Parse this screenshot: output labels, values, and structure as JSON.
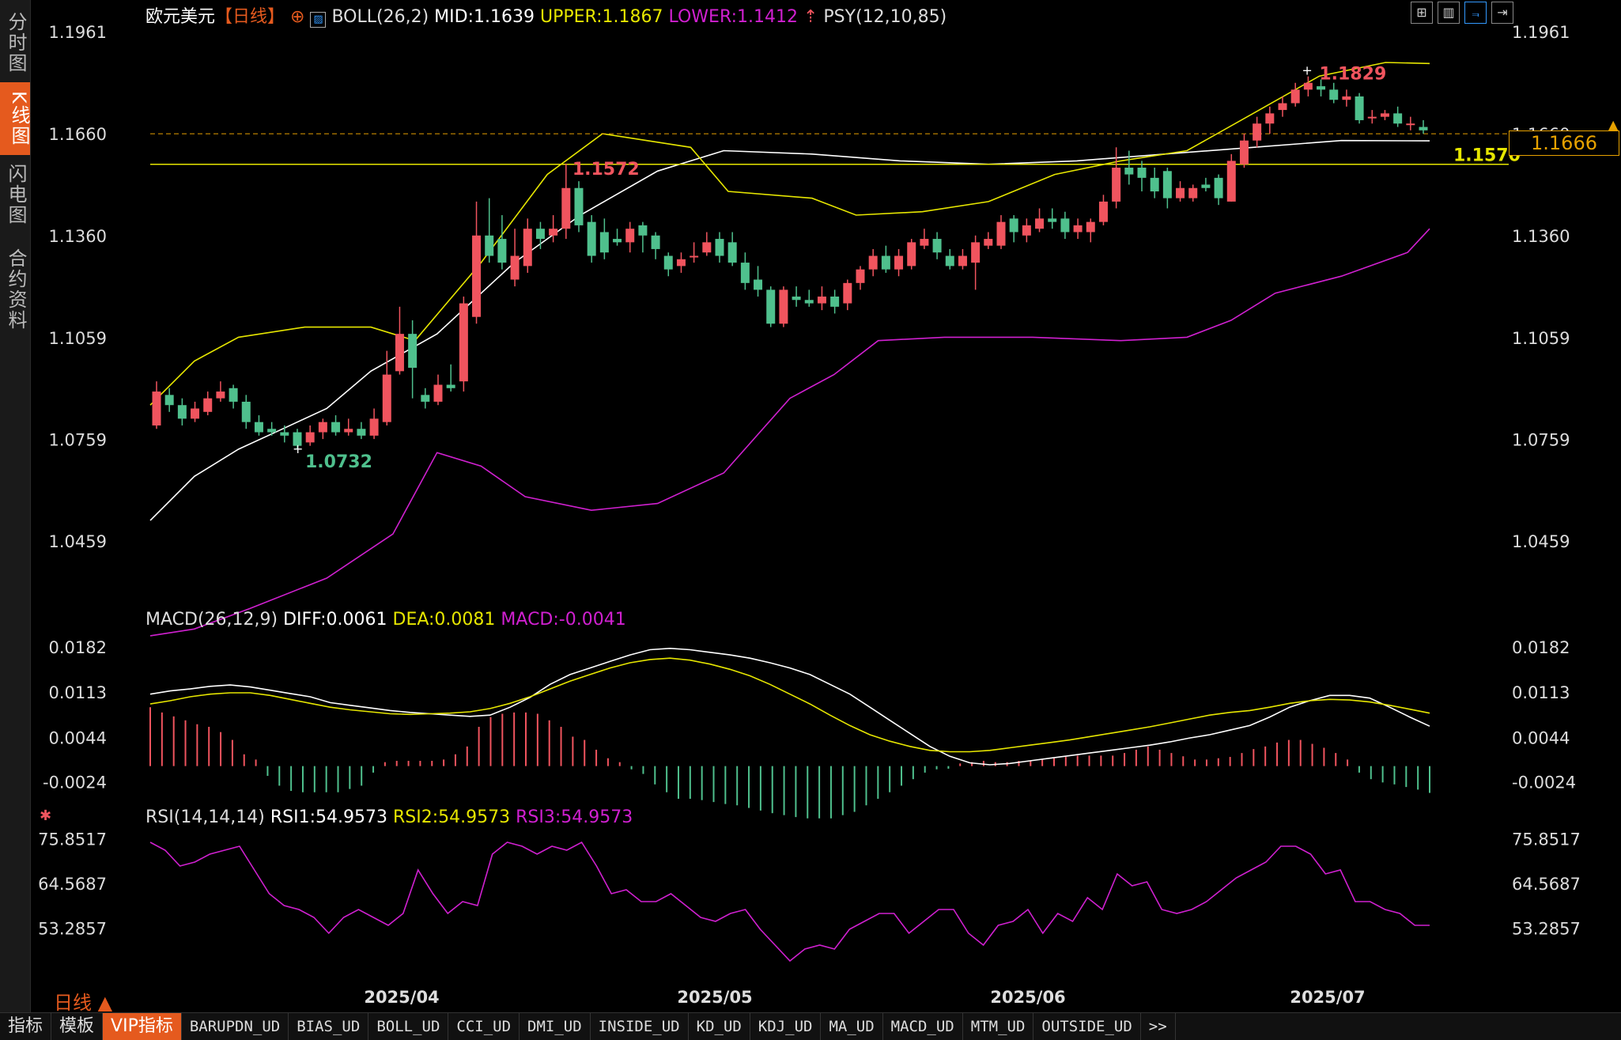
{
  "sidebar": {
    "tabs": [
      "分时图",
      "K线图",
      "闪电图",
      "合约资料"
    ],
    "active": 1
  },
  "header": {
    "symbol": "欧元美元",
    "period_tag": "【日线】",
    "boll": "BOLL(26,2)",
    "mid": "MID:1.1639",
    "upper": "UPPER:1.1867",
    "lower": "LOWER:1.1412",
    "psy": "PSY(12,10,85)"
  },
  "toolbar": {
    "icons": [
      "grid-icon",
      "candle-chart-icon",
      "line-chart-icon",
      "expand-icon"
    ]
  },
  "price_tag": "1.1666",
  "macd_header": {
    "label": "MACD(26,12,9)",
    "diff": "DIFF:0.0061",
    "dea": "DEA:0.0081",
    "macd": "MACD:-0.0041"
  },
  "rsi_header": {
    "label": "RSI(14,14,14)",
    "rsi1": "RSI1:54.9573",
    "rsi2": "RSI2:54.9573",
    "rsi3": "RSI3:54.9573"
  },
  "period_label": "日线 ▲",
  "bottom_tabs": [
    "指标",
    "模板",
    "VIP指标",
    "BARUPDN_UD",
    "BIAS_UD",
    "BOLL_UD",
    "CCI_UD",
    "DMI_UD",
    "INSIDE_UD",
    "KD_UD",
    "KDJ_UD",
    "MA_UD",
    "MACD_UD",
    "MTM_UD",
    "OUTSIDE_UD",
    ">>"
  ],
  "bottom_active": 2,
  "colors": {
    "up": "#f0545e",
    "down": "#4fc08d",
    "mid": "#ffffff",
    "upper": "#e6e600",
    "lower": "#d020d0",
    "macd_up": "#f0545e",
    "macd_down": "#4fc08d",
    "hline": "#e6e600",
    "accent": "#e55a1e"
  },
  "chart_data": {
    "type": "candlestick",
    "x_labels": [
      "2025/04",
      "2025/05",
      "2025/06",
      "2025/07"
    ],
    "price_ticks": [
      "1.1961",
      "1.1660",
      "1.1360",
      "1.1059",
      "1.0759",
      "1.0459"
    ],
    "price_ylim": [
      1.0259,
      1.1961
    ],
    "annotations": {
      "high_label": "1.1829",
      "high_value": 1.1829,
      "mid_high_label": "1.1572",
      "mid_high_value": 1.1572,
      "low_label": "1.0732",
      "low_value": 1.0732,
      "hline_label": "1.1570",
      "hline_value": 1.157,
      "last_price": 1.166
    },
    "candles": [
      {
        "o": 1.08,
        "c": 1.09,
        "h": 1.093,
        "l": 1.079
      },
      {
        "o": 1.089,
        "c": 1.086,
        "h": 1.091,
        "l": 1.084
      },
      {
        "o": 1.086,
        "c": 1.082,
        "h": 1.088,
        "l": 1.08
      },
      {
        "o": 1.082,
        "c": 1.085,
        "h": 1.087,
        "l": 1.081
      },
      {
        "o": 1.084,
        "c": 1.088,
        "h": 1.09,
        "l": 1.083
      },
      {
        "o": 1.088,
        "c": 1.09,
        "h": 1.093,
        "l": 1.087
      },
      {
        "o": 1.091,
        "c": 1.087,
        "h": 1.092,
        "l": 1.085
      },
      {
        "o": 1.087,
        "c": 1.081,
        "h": 1.089,
        "l": 1.079
      },
      {
        "o": 1.081,
        "c": 1.078,
        "h": 1.083,
        "l": 1.077
      },
      {
        "o": 1.079,
        "c": 1.078,
        "h": 1.081,
        "l": 1.077
      },
      {
        "o": 1.078,
        "c": 1.077,
        "h": 1.08,
        "l": 1.075
      },
      {
        "o": 1.078,
        "c": 1.074,
        "h": 1.079,
        "l": 1.0732
      },
      {
        "o": 1.075,
        "c": 1.078,
        "h": 1.08,
        "l": 1.074
      },
      {
        "o": 1.078,
        "c": 1.081,
        "h": 1.082,
        "l": 1.076
      },
      {
        "o": 1.081,
        "c": 1.078,
        "h": 1.083,
        "l": 1.077
      },
      {
        "o": 1.078,
        "c": 1.079,
        "h": 1.082,
        "l": 1.077
      },
      {
        "o": 1.079,
        "c": 1.077,
        "h": 1.081,
        "l": 1.076
      },
      {
        "o": 1.077,
        "c": 1.082,
        "h": 1.085,
        "l": 1.076
      },
      {
        "o": 1.081,
        "c": 1.095,
        "h": 1.102,
        "l": 1.08
      },
      {
        "o": 1.096,
        "c": 1.107,
        "h": 1.115,
        "l": 1.095
      },
      {
        "o": 1.107,
        "c": 1.097,
        "h": 1.111,
        "l": 1.088
      },
      {
        "o": 1.089,
        "c": 1.087,
        "h": 1.091,
        "l": 1.085
      },
      {
        "o": 1.087,
        "c": 1.092,
        "h": 1.095,
        "l": 1.086
      },
      {
        "o": 1.092,
        "c": 1.091,
        "h": 1.098,
        "l": 1.09
      },
      {
        "o": 1.093,
        "c": 1.116,
        "h": 1.118,
        "l": 1.09
      },
      {
        "o": 1.112,
        "c": 1.136,
        "h": 1.146,
        "l": 1.11
      },
      {
        "o": 1.136,
        "c": 1.13,
        "h": 1.147,
        "l": 1.128
      },
      {
        "o": 1.135,
        "c": 1.128,
        "h": 1.142,
        "l": 1.126
      },
      {
        "o": 1.123,
        "c": 1.13,
        "h": 1.138,
        "l": 1.121
      },
      {
        "o": 1.127,
        "c": 1.138,
        "h": 1.141,
        "l": 1.125
      },
      {
        "o": 1.138,
        "c": 1.135,
        "h": 1.14,
        "l": 1.132
      },
      {
        "o": 1.136,
        "c": 1.138,
        "h": 1.142,
        "l": 1.134
      },
      {
        "o": 1.138,
        "c": 1.15,
        "h": 1.1572,
        "l": 1.135
      },
      {
        "o": 1.15,
        "c": 1.139,
        "h": 1.152,
        "l": 1.137
      },
      {
        "o": 1.14,
        "c": 1.13,
        "h": 1.142,
        "l": 1.128
      },
      {
        "o": 1.137,
        "c": 1.131,
        "h": 1.141,
        "l": 1.129
      },
      {
        "o": 1.135,
        "c": 1.134,
        "h": 1.138,
        "l": 1.133
      },
      {
        "o": 1.134,
        "c": 1.138,
        "h": 1.14,
        "l": 1.131
      },
      {
        "o": 1.139,
        "c": 1.136,
        "h": 1.14,
        "l": 1.131
      },
      {
        "o": 1.136,
        "c": 1.132,
        "h": 1.137,
        "l": 1.129
      },
      {
        "o": 1.13,
        "c": 1.126,
        "h": 1.131,
        "l": 1.124
      },
      {
        "o": 1.127,
        "c": 1.129,
        "h": 1.131,
        "l": 1.125
      },
      {
        "o": 1.13,
        "c": 1.13,
        "h": 1.134,
        "l": 1.128
      },
      {
        "o": 1.131,
        "c": 1.134,
        "h": 1.137,
        "l": 1.13
      },
      {
        "o": 1.135,
        "c": 1.13,
        "h": 1.137,
        "l": 1.128
      },
      {
        "o": 1.134,
        "c": 1.128,
        "h": 1.137,
        "l": 1.127
      },
      {
        "o": 1.128,
        "c": 1.122,
        "h": 1.131,
        "l": 1.12
      },
      {
        "o": 1.123,
        "c": 1.12,
        "h": 1.127,
        "l": 1.118
      },
      {
        "o": 1.12,
        "c": 1.11,
        "h": 1.121,
        "l": 1.109
      },
      {
        "o": 1.11,
        "c": 1.12,
        "h": 1.121,
        "l": 1.109
      },
      {
        "o": 1.118,
        "c": 1.117,
        "h": 1.121,
        "l": 1.115
      },
      {
        "o": 1.117,
        "c": 1.116,
        "h": 1.12,
        "l": 1.115
      },
      {
        "o": 1.116,
        "c": 1.118,
        "h": 1.121,
        "l": 1.114
      },
      {
        "o": 1.118,
        "c": 1.115,
        "h": 1.12,
        "l": 1.113
      },
      {
        "o": 1.116,
        "c": 1.122,
        "h": 1.123,
        "l": 1.114
      },
      {
        "o": 1.122,
        "c": 1.126,
        "h": 1.127,
        "l": 1.12
      },
      {
        "o": 1.126,
        "c": 1.13,
        "h": 1.132,
        "l": 1.124
      },
      {
        "o": 1.13,
        "c": 1.126,
        "h": 1.133,
        "l": 1.125
      },
      {
        "o": 1.126,
        "c": 1.13,
        "h": 1.132,
        "l": 1.124
      },
      {
        "o": 1.127,
        "c": 1.134,
        "h": 1.135,
        "l": 1.126
      },
      {
        "o": 1.133,
        "c": 1.135,
        "h": 1.138,
        "l": 1.132
      },
      {
        "o": 1.135,
        "c": 1.131,
        "h": 1.137,
        "l": 1.129
      },
      {
        "o": 1.13,
        "c": 1.127,
        "h": 1.132,
        "l": 1.126
      },
      {
        "o": 1.127,
        "c": 1.13,
        "h": 1.132,
        "l": 1.126
      },
      {
        "o": 1.128,
        "c": 1.134,
        "h": 1.136,
        "l": 1.12
      },
      {
        "o": 1.133,
        "c": 1.135,
        "h": 1.137,
        "l": 1.132
      },
      {
        "o": 1.133,
        "c": 1.14,
        "h": 1.142,
        "l": 1.132
      },
      {
        "o": 1.141,
        "c": 1.137,
        "h": 1.142,
        "l": 1.134
      },
      {
        "o": 1.136,
        "c": 1.139,
        "h": 1.141,
        "l": 1.134
      },
      {
        "o": 1.138,
        "c": 1.141,
        "h": 1.144,
        "l": 1.137
      },
      {
        "o": 1.141,
        "c": 1.14,
        "h": 1.144,
        "l": 1.138
      },
      {
        "o": 1.141,
        "c": 1.137,
        "h": 1.143,
        "l": 1.135
      },
      {
        "o": 1.137,
        "c": 1.139,
        "h": 1.141,
        "l": 1.135
      },
      {
        "o": 1.137,
        "c": 1.14,
        "h": 1.141,
        "l": 1.134
      },
      {
        "o": 1.14,
        "c": 1.146,
        "h": 1.148,
        "l": 1.139
      },
      {
        "o": 1.146,
        "c": 1.156,
        "h": 1.162,
        "l": 1.144
      },
      {
        "o": 1.156,
        "c": 1.154,
        "h": 1.161,
        "l": 1.151
      },
      {
        "o": 1.156,
        "c": 1.153,
        "h": 1.158,
        "l": 1.149
      },
      {
        "o": 1.153,
        "c": 1.149,
        "h": 1.156,
        "l": 1.147
      },
      {
        "o": 1.155,
        "c": 1.147,
        "h": 1.156,
        "l": 1.144
      },
      {
        "o": 1.147,
        "c": 1.15,
        "h": 1.152,
        "l": 1.146
      },
      {
        "o": 1.147,
        "c": 1.15,
        "h": 1.151,
        "l": 1.146
      },
      {
        "o": 1.151,
        "c": 1.15,
        "h": 1.153,
        "l": 1.149
      },
      {
        "o": 1.153,
        "c": 1.147,
        "h": 1.154,
        "l": 1.145
      },
      {
        "o": 1.146,
        "c": 1.158,
        "h": 1.16,
        "l": 1.146
      },
      {
        "o": 1.157,
        "c": 1.164,
        "h": 1.166,
        "l": 1.156
      },
      {
        "o": 1.164,
        "c": 1.169,
        "h": 1.171,
        "l": 1.162
      },
      {
        "o": 1.169,
        "c": 1.172,
        "h": 1.174,
        "l": 1.166
      },
      {
        "o": 1.173,
        "c": 1.175,
        "h": 1.177,
        "l": 1.171
      },
      {
        "o": 1.175,
        "c": 1.179,
        "h": 1.181,
        "l": 1.174
      },
      {
        "o": 1.179,
        "c": 1.181,
        "h": 1.1829,
        "l": 1.177
      },
      {
        "o": 1.18,
        "c": 1.179,
        "h": 1.182,
        "l": 1.177
      },
      {
        "o": 1.179,
        "c": 1.176,
        "h": 1.181,
        "l": 1.175
      },
      {
        "o": 1.176,
        "c": 1.177,
        "h": 1.179,
        "l": 1.174
      },
      {
        "o": 1.177,
        "c": 1.17,
        "h": 1.178,
        "l": 1.169
      },
      {
        "o": 1.171,
        "c": 1.171,
        "h": 1.173,
        "l": 1.169
      },
      {
        "o": 1.171,
        "c": 1.172,
        "h": 1.173,
        "l": 1.17
      },
      {
        "o": 1.172,
        "c": 1.169,
        "h": 1.174,
        "l": 1.168
      },
      {
        "o": 1.169,
        "c": 1.169,
        "h": 1.171,
        "l": 1.167
      },
      {
        "o": 1.168,
        "c": 1.167,
        "h": 1.17,
        "l": 1.166
      }
    ],
    "boll_mid": [
      [
        0,
        1.052
      ],
      [
        20,
        1.065
      ],
      [
        40,
        1.073
      ],
      [
        60,
        1.079
      ],
      [
        80,
        1.085
      ],
      [
        100,
        1.096
      ],
      [
        130,
        1.107
      ],
      [
        165,
        1.128
      ],
      [
        195,
        1.142
      ],
      [
        230,
        1.155
      ],
      [
        260,
        1.161
      ],
      [
        300,
        1.16
      ],
      [
        340,
        1.158
      ],
      [
        380,
        1.157
      ],
      [
        420,
        1.158
      ],
      [
        460,
        1.16
      ],
      [
        500,
        1.162
      ],
      [
        540,
        1.164
      ],
      [
        580,
        1.1639
      ]
    ],
    "boll_upper": [
      [
        0,
        1.086
      ],
      [
        20,
        1.099
      ],
      [
        40,
        1.106
      ],
      [
        70,
        1.109
      ],
      [
        100,
        1.109
      ],
      [
        120,
        1.105
      ],
      [
        150,
        1.128
      ],
      [
        180,
        1.154
      ],
      [
        205,
        1.166
      ],
      [
        245,
        1.162
      ],
      [
        262,
        1.149
      ],
      [
        300,
        1.147
      ],
      [
        320,
        1.142
      ],
      [
        350,
        1.143
      ],
      [
        380,
        1.146
      ],
      [
        410,
        1.154
      ],
      [
        440,
        1.158
      ],
      [
        470,
        1.161
      ],
      [
        500,
        1.172
      ],
      [
        530,
        1.183
      ],
      [
        560,
        1.187
      ],
      [
        580,
        1.1867
      ]
    ],
    "boll_lower": [
      [
        0,
        1.018
      ],
      [
        20,
        1.02
      ],
      [
        45,
        1.026
      ],
      [
        80,
        1.035
      ],
      [
        110,
        1.048
      ],
      [
        130,
        1.072
      ],
      [
        150,
        1.068
      ],
      [
        170,
        1.059
      ],
      [
        200,
        1.055
      ],
      [
        230,
        1.057
      ],
      [
        260,
        1.066
      ],
      [
        290,
        1.088
      ],
      [
        310,
        1.095
      ],
      [
        330,
        1.105
      ],
      [
        360,
        1.106
      ],
      [
        400,
        1.106
      ],
      [
        440,
        1.105
      ],
      [
        470,
        1.106
      ],
      [
        490,
        1.111
      ],
      [
        510,
        1.119
      ],
      [
        540,
        1.124
      ],
      [
        570,
        1.131
      ],
      [
        580,
        1.138
      ]
    ],
    "macd_ticks": [
      "0.0182",
      "0.0113",
      "0.0044",
      "-0.0024"
    ],
    "macd_ylim": [
      -0.005,
      0.021
    ],
    "macd_diff": [
      0.011,
      0.0115,
      0.0118,
      0.0122,
      0.0124,
      0.0121,
      0.0116,
      0.0111,
      0.0106,
      0.0097,
      0.0093,
      0.0089,
      0.0085,
      0.0082,
      0.008,
      0.0078,
      0.0076,
      0.0078,
      0.009,
      0.0105,
      0.0125,
      0.014,
      0.015,
      0.016,
      0.017,
      0.0178,
      0.018,
      0.0178,
      0.0174,
      0.017,
      0.0165,
      0.0158,
      0.015,
      0.014,
      0.0125,
      0.011,
      0.009,
      0.007,
      0.005,
      0.003,
      0.0015,
      0.0005,
      0.0002,
      0.0004,
      0.0008,
      0.0012,
      0.0016,
      0.002,
      0.0024,
      0.0028,
      0.0032,
      0.0037,
      0.0043,
      0.0048,
      0.0055,
      0.0062,
      0.0075,
      0.009,
      0.01,
      0.0108,
      0.0108,
      0.0104,
      0.009,
      0.0075,
      0.0061
    ],
    "macd_dea": [
      0.0095,
      0.01,
      0.0106,
      0.011,
      0.0112,
      0.0112,
      0.0108,
      0.0102,
      0.0096,
      0.009,
      0.0086,
      0.0083,
      0.008,
      0.0079,
      0.008,
      0.0081,
      0.0083,
      0.0088,
      0.0096,
      0.0106,
      0.0118,
      0.013,
      0.014,
      0.015,
      0.0158,
      0.0163,
      0.0165,
      0.0162,
      0.0156,
      0.0148,
      0.0138,
      0.0125,
      0.011,
      0.0095,
      0.0078,
      0.0062,
      0.0048,
      0.0038,
      0.003,
      0.0024,
      0.0022,
      0.0022,
      0.0024,
      0.0028,
      0.0032,
      0.0036,
      0.004,
      0.0045,
      0.005,
      0.0055,
      0.006,
      0.0066,
      0.0072,
      0.0078,
      0.0082,
      0.0085,
      0.009,
      0.0096,
      0.01,
      0.0102,
      0.0101,
      0.0098,
      0.0093,
      0.0087,
      0.0081
    ],
    "macd_bars": [
      0.009,
      0.0082,
      0.0076,
      0.007,
      0.0064,
      0.006,
      0.0052,
      0.004,
      0.0018,
      0.001,
      -0.0015,
      -0.003,
      -0.0038,
      -0.004,
      -0.004,
      -0.004,
      -0.004,
      -0.0035,
      -0.003,
      -0.001,
      0.0006,
      0.0008,
      0.0008,
      0.0008,
      0.0008,
      0.001,
      0.0018,
      0.003,
      0.006,
      0.0075,
      0.008,
      0.0082,
      0.0082,
      0.008,
      0.007,
      0.006,
      0.0045,
      0.004,
      0.0025,
      0.0012,
      0.0006,
      -0.0005,
      -0.0012,
      -0.0028,
      -0.004,
      -0.005,
      -0.005,
      -0.0052,
      -0.0055,
      -0.0058,
      -0.006,
      -0.0064,
      -0.0068,
      -0.0072,
      -0.0075,
      -0.0078,
      -0.008,
      -0.008,
      -0.008,
      -0.0075,
      -0.007,
      -0.006,
      -0.005,
      -0.004,
      -0.003,
      -0.002,
      -0.001,
      -0.0005,
      -0.0004,
      0.0004,
      0.0006,
      0.0008,
      0.0006,
      0.0006,
      0.0008,
      0.0008,
      0.001,
      0.0012,
      0.0014,
      0.0016,
      0.0016,
      0.0016,
      0.0016,
      0.002,
      0.0025,
      0.003,
      0.0025,
      0.002,
      0.0015,
      0.001,
      0.001,
      0.0012,
      0.0014,
      0.002,
      0.0026,
      0.003,
      0.0036,
      0.004,
      0.004,
      0.0034,
      0.0028,
      0.002,
      0.001,
      -0.001,
      -0.002,
      -0.0025,
      -0.0028,
      -0.0032,
      -0.0036,
      -0.0041
    ],
    "rsi_ticks": [
      "75.8517",
      "64.5687",
      "53.2857"
    ],
    "rsi_ylim": [
      42,
      80
    ],
    "rsi": [
      75,
      73,
      69,
      70,
      72,
      73,
      74,
      68,
      62,
      59,
      58,
      56,
      52,
      56,
      58,
      56,
      54,
      57,
      68,
      62,
      57,
      60,
      59,
      72,
      75,
      74,
      72,
      74,
      73,
      75,
      69,
      62,
      63,
      60,
      60,
      62,
      59,
      56,
      55,
      57,
      58,
      53,
      49,
      45,
      48,
      49,
      48,
      53,
      55,
      57,
      57,
      52,
      55,
      58,
      58,
      52,
      49,
      54,
      55,
      58,
      52,
      57,
      55,
      61,
      58,
      67,
      64,
      65,
      58,
      57,
      58,
      60,
      63,
      66,
      68,
      70,
      74,
      74,
      72,
      67,
      68,
      60,
      60,
      58,
      57,
      54,
      54
    ]
  }
}
